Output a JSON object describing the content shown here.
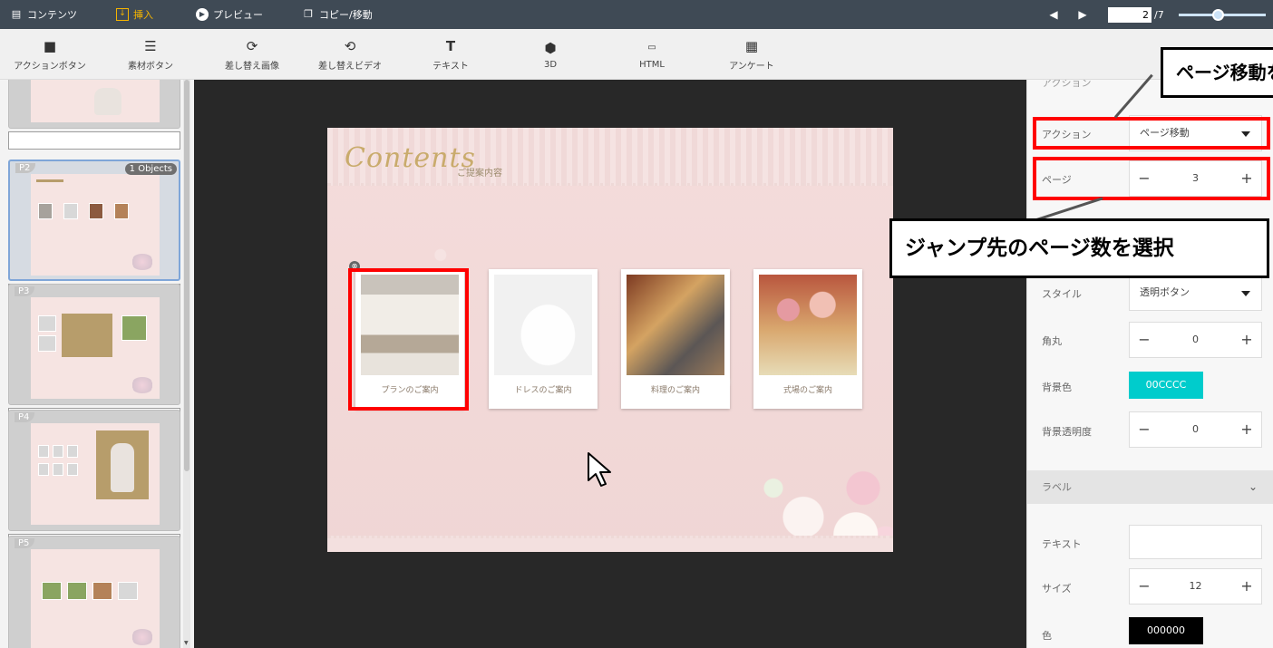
{
  "topbar": {
    "menus": [
      {
        "label": "コンテンツ",
        "icon": "document-icon"
      },
      {
        "label": "挿入",
        "icon": "insert-icon"
      },
      {
        "label": "プレビュー",
        "icon": "play-icon"
      },
      {
        "label": "コピー/移動",
        "icon": "copy-icon"
      }
    ],
    "active_menu": "挿入",
    "active_color": "#f4b400",
    "background": "#3f4a55",
    "pager": {
      "current": "2",
      "total": "/7",
      "zoom_fraction": 0.45
    }
  },
  "toolbar": {
    "items": [
      {
        "label": "アクションボタン",
        "icon": "square-button-icon"
      },
      {
        "label": "素材ボタン",
        "icon": "list-icon"
      },
      {
        "label": "差し替え画像",
        "icon": "image-swap-icon"
      },
      {
        "label": "差し替えビデオ",
        "icon": "video-swap-icon"
      },
      {
        "label": "テキスト",
        "icon": "text-icon"
      },
      {
        "label": "3D",
        "icon": "cube-icon"
      },
      {
        "label": "HTML",
        "icon": "html-icon"
      },
      {
        "label": "アンケート",
        "icon": "survey-icon"
      }
    ]
  },
  "pages": {
    "items": [
      {
        "tag": "",
        "badge": ""
      },
      {
        "tag": "P2",
        "badge": "1 Objects",
        "selected": true
      },
      {
        "tag": "P3",
        "badge": ""
      },
      {
        "tag": "P4",
        "badge": ""
      },
      {
        "tag": "P5",
        "badge": ""
      }
    ]
  },
  "slide": {
    "title": "Contents",
    "subtitle": "ご提案内容",
    "cards": [
      {
        "caption": "プランのご案内",
        "photo": "chapel"
      },
      {
        "caption": "ドレスのご案内",
        "photo": "dress"
      },
      {
        "caption": "料理のご案内",
        "photo": "food"
      },
      {
        "caption": "式場のご案内",
        "photo": "venue"
      }
    ]
  },
  "panel": {
    "section_partial": "アクション",
    "action": {
      "label": "アクション",
      "value": "ページ移動"
    },
    "page": {
      "label": "ページ",
      "value": "3"
    },
    "style": {
      "label": "スタイル",
      "value": "透明ボタン"
    },
    "radius": {
      "label": "角丸",
      "value": "0"
    },
    "bgcolor": {
      "label": "背景色",
      "value": "00CCCC",
      "color": "#00cccc"
    },
    "bgopacity": {
      "label": "背景透明度",
      "value": "0"
    },
    "label_section": {
      "title": "ラベル"
    },
    "text": {
      "label": "テキスト",
      "value": ""
    },
    "size": {
      "label": "サイズ",
      "value": "12"
    },
    "color": {
      "label": "色",
      "value": "000000",
      "color": "#000000"
    }
  },
  "callouts": {
    "top": "ページ移動を選択",
    "middle": "ジャンプ先のページ数を選択"
  },
  "highlight_color": "#ff0000"
}
